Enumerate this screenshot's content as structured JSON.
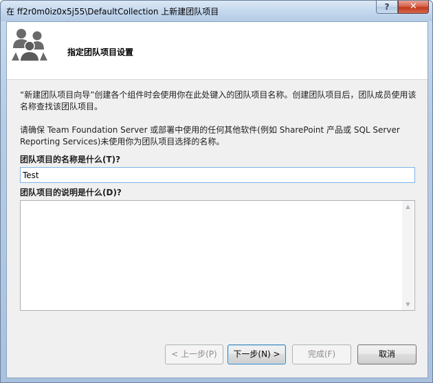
{
  "window": {
    "title": "在 ff2r0m0iz0x5j55\\DefaultCollection 上新建团队项目",
    "help_glyph": "?",
    "close_glyph": "✕"
  },
  "banner": {
    "icon": "team-people-icon",
    "title": "指定团队项目设置"
  },
  "body": {
    "description_1": "“新建团队项目向导”创建各个组件时会使用你在此处键入的团队项目名称。创建团队项目后，团队成员使用该名称查找该团队项目。",
    "description_2": "请确保 Team Foundation Server 或部署中使用的任何其他软件(例如 SharePoint 产品或 SQL Server Reporting Services)未使用你为团队项目选择的名称。",
    "name_label": "团队项目的名称是什么(T)?",
    "name_value": "Test",
    "desc_label": "团队项目的说明是什么(D)?",
    "desc_value": ""
  },
  "buttons": {
    "prev": "< 上一步(P)",
    "next": "下一步(N) >",
    "finish": "完成(F)",
    "cancel": "取消"
  },
  "colors": {
    "input_focus_border": "#7eb4ea",
    "default_button_border": "#3c7fb1",
    "close_button": "#c2391c"
  }
}
